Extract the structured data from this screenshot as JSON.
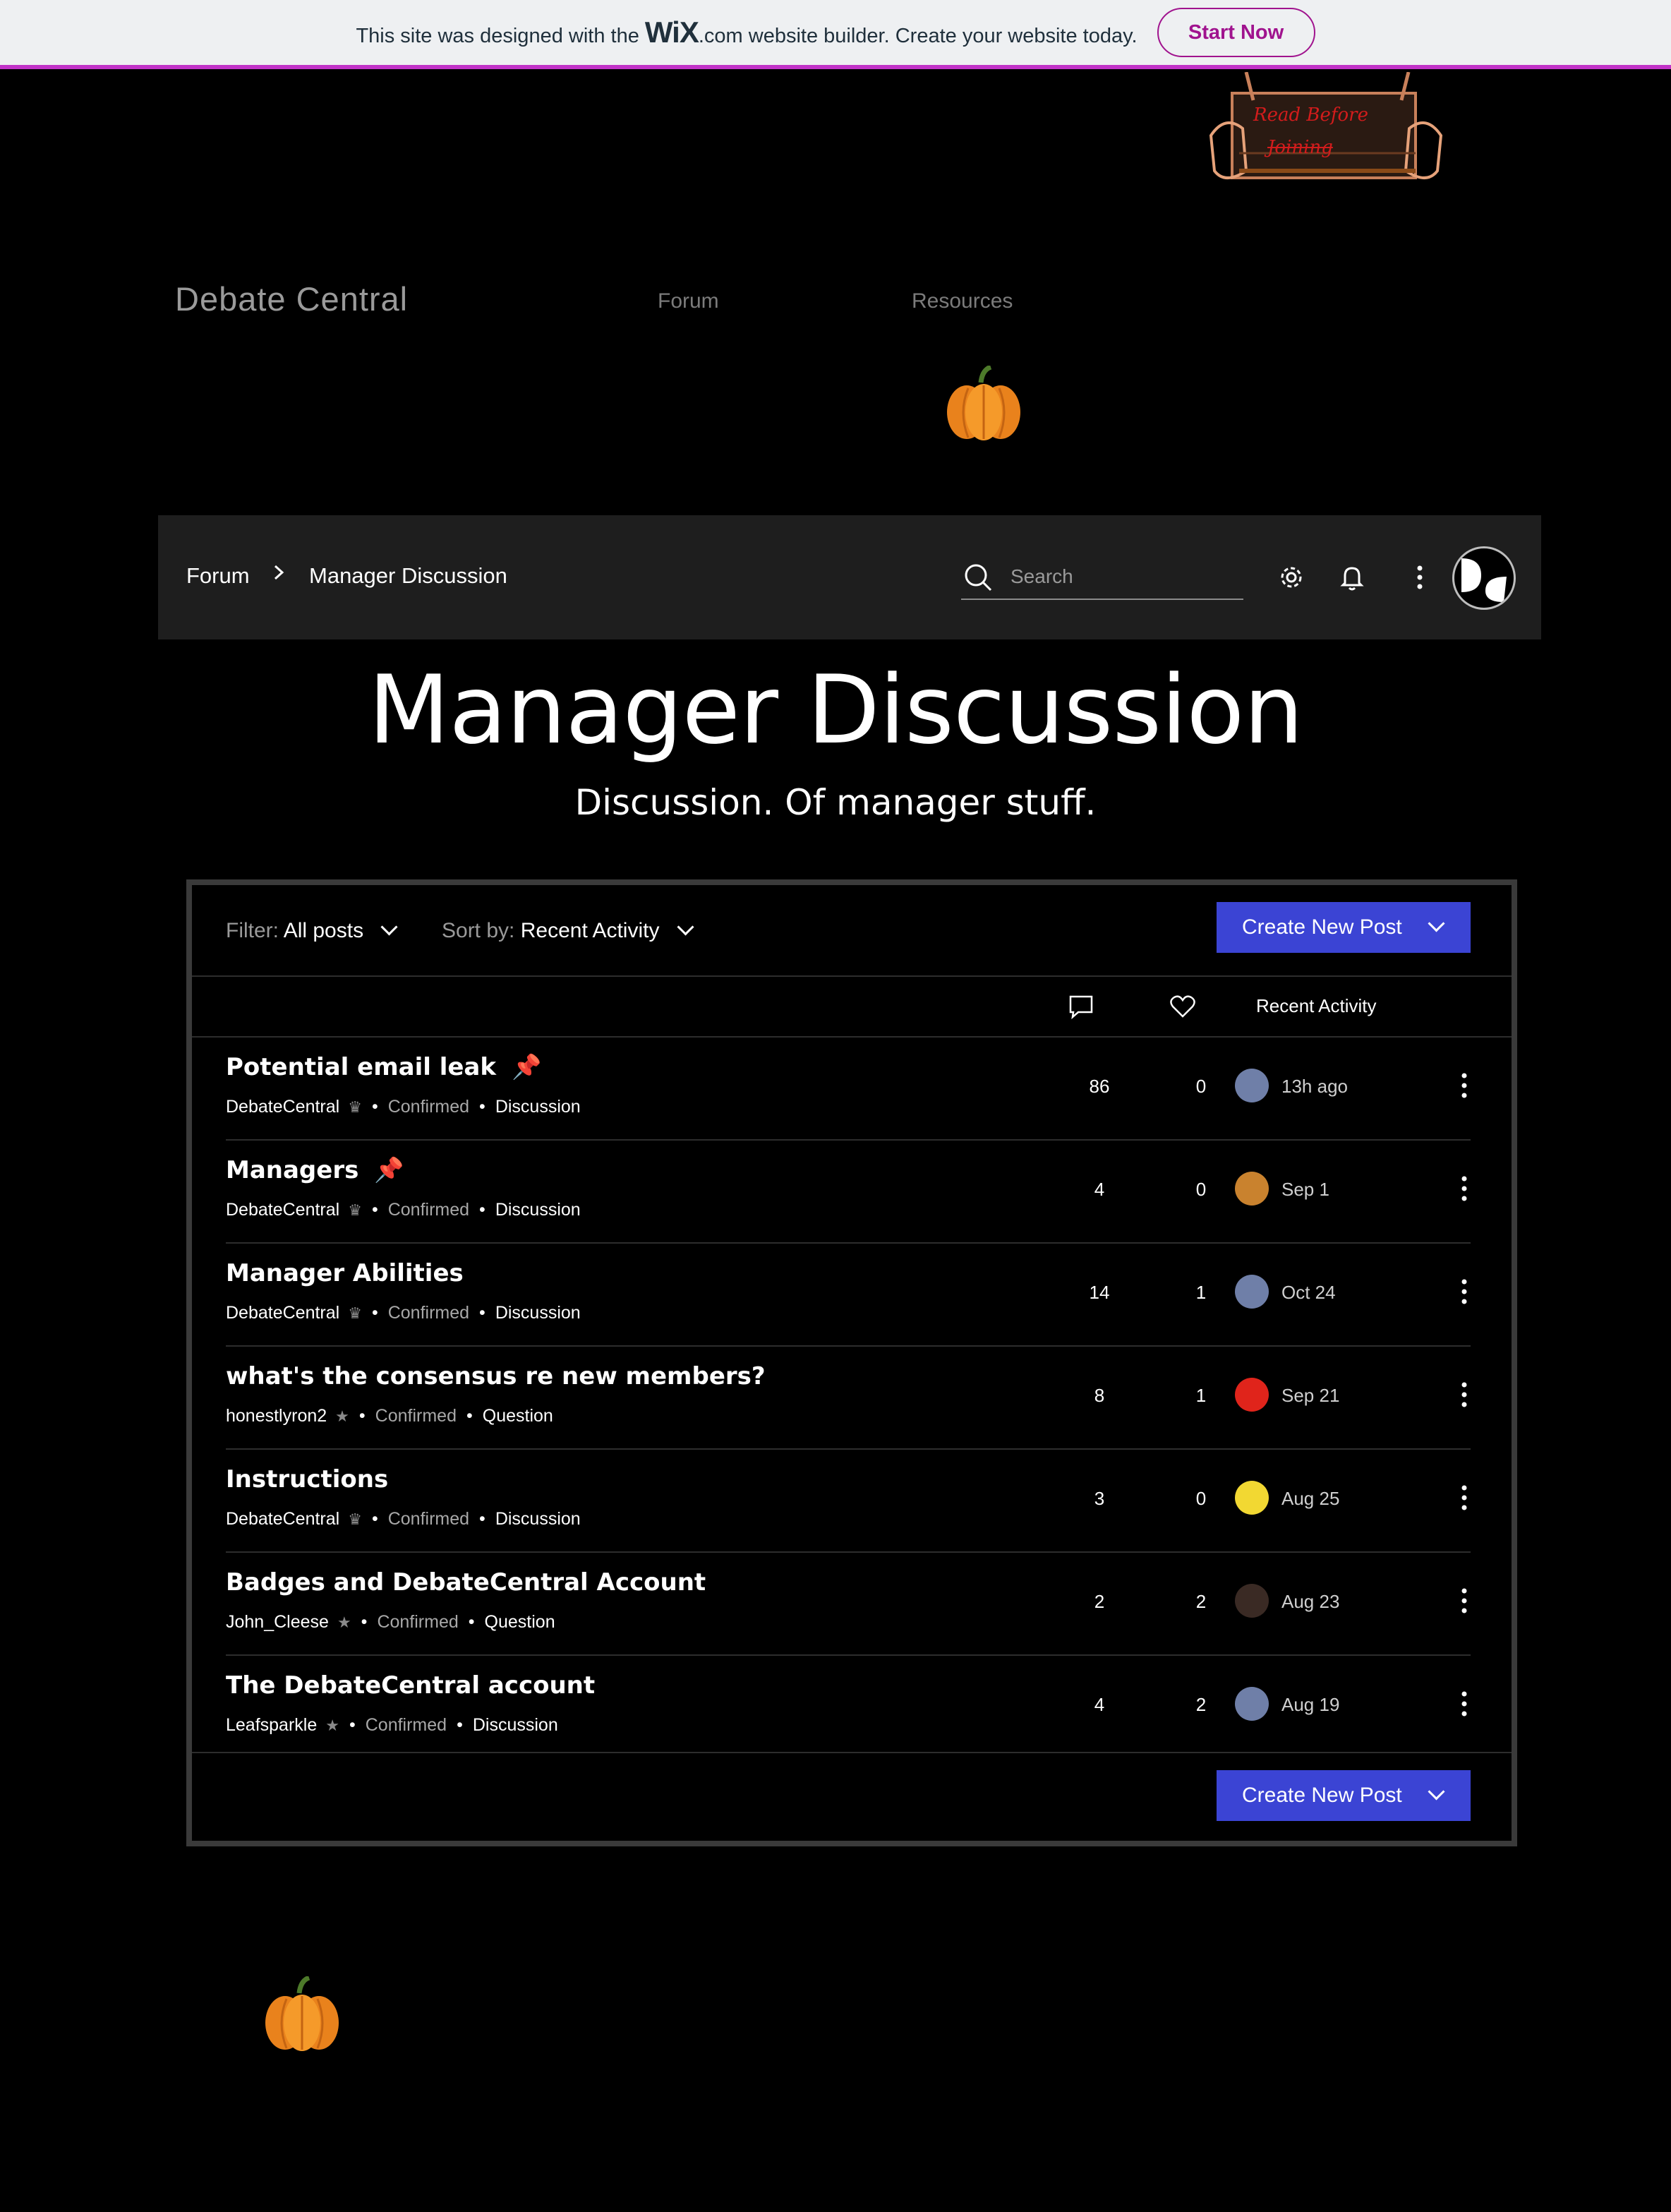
{
  "wix_banner": {
    "text_before": "This site was designed with the",
    "logo": "WiX",
    "text_after": ".com website builder. Create your website today.",
    "button": "Start Now"
  },
  "sign": {
    "text_line1": "Read Before",
    "text_line2": "Joining"
  },
  "site": {
    "title": "Debate Central",
    "nav": [
      "Forum",
      "Resources"
    ]
  },
  "forum_bar": {
    "breadcrumb": [
      "Forum",
      "Manager Discussion"
    ],
    "search_placeholder": "Search",
    "icons": [
      "search-icon",
      "settings-icon",
      "bell-icon",
      "more-icon"
    ]
  },
  "page": {
    "title": "Manager Discussion",
    "subtitle": "Discussion. Of manager stuff."
  },
  "toolbar": {
    "filter_label": "Filter:",
    "filter_value": "All posts",
    "sort_label": "Sort by:",
    "sort_value": "Recent Activity",
    "create_button": "Create New Post"
  },
  "columns": {
    "comments_icon": "comment-icon",
    "likes_icon": "heart-icon",
    "activity": "Recent Activity"
  },
  "posts": [
    {
      "title": "Potential email leak",
      "pinned": true,
      "author": "DebateCentral",
      "badge": "crown",
      "status": "Confirmed",
      "category": "Discussion",
      "comments": "86",
      "likes": "0",
      "activity": "13h ago",
      "avatar_color": "#6f7fa8"
    },
    {
      "title": "Managers",
      "pinned": true,
      "author": "DebateCentral",
      "badge": "crown",
      "status": "Confirmed",
      "category": "Discussion",
      "comments": "4",
      "likes": "0",
      "activity": "Sep 1",
      "avatar_color": "#c9822e"
    },
    {
      "title": "Manager Abilities",
      "pinned": false,
      "author": "DebateCentral",
      "badge": "crown",
      "status": "Confirmed",
      "category": "Discussion",
      "comments": "14",
      "likes": "1",
      "activity": "Oct 24",
      "avatar_color": "#6f7fa8"
    },
    {
      "title": "what's the consensus re new members?",
      "pinned": false,
      "author": "honestlyron2",
      "badge": "star",
      "status": "Confirmed",
      "category": "Question",
      "comments": "8",
      "likes": "1",
      "activity": "Sep 21",
      "avatar_color": "#e0241b"
    },
    {
      "title": "Instructions",
      "pinned": false,
      "author": "DebateCentral",
      "badge": "crown",
      "status": "Confirmed",
      "category": "Discussion",
      "comments": "3",
      "likes": "0",
      "activity": "Aug 25",
      "avatar_color": "#f2d832"
    },
    {
      "title": "Badges and DebateCentral Account",
      "pinned": false,
      "author": "John_Cleese",
      "badge": "star",
      "status": "Confirmed",
      "category": "Question",
      "comments": "2",
      "likes": "2",
      "activity": "Aug 23",
      "avatar_color": "#3a2a24"
    },
    {
      "title": "The DebateCentral account",
      "pinned": false,
      "author": "Leafsparkle",
      "badge": "star",
      "status": "Confirmed",
      "category": "Discussion",
      "comments": "4",
      "likes": "2",
      "activity": "Aug 19",
      "avatar_color": "#6f7fa8"
    }
  ],
  "colors": {
    "accent": "#3b44d4",
    "wix_brand": "#a0138e",
    "pin": "#e9512b",
    "panel_border": "#3a3a3a"
  }
}
